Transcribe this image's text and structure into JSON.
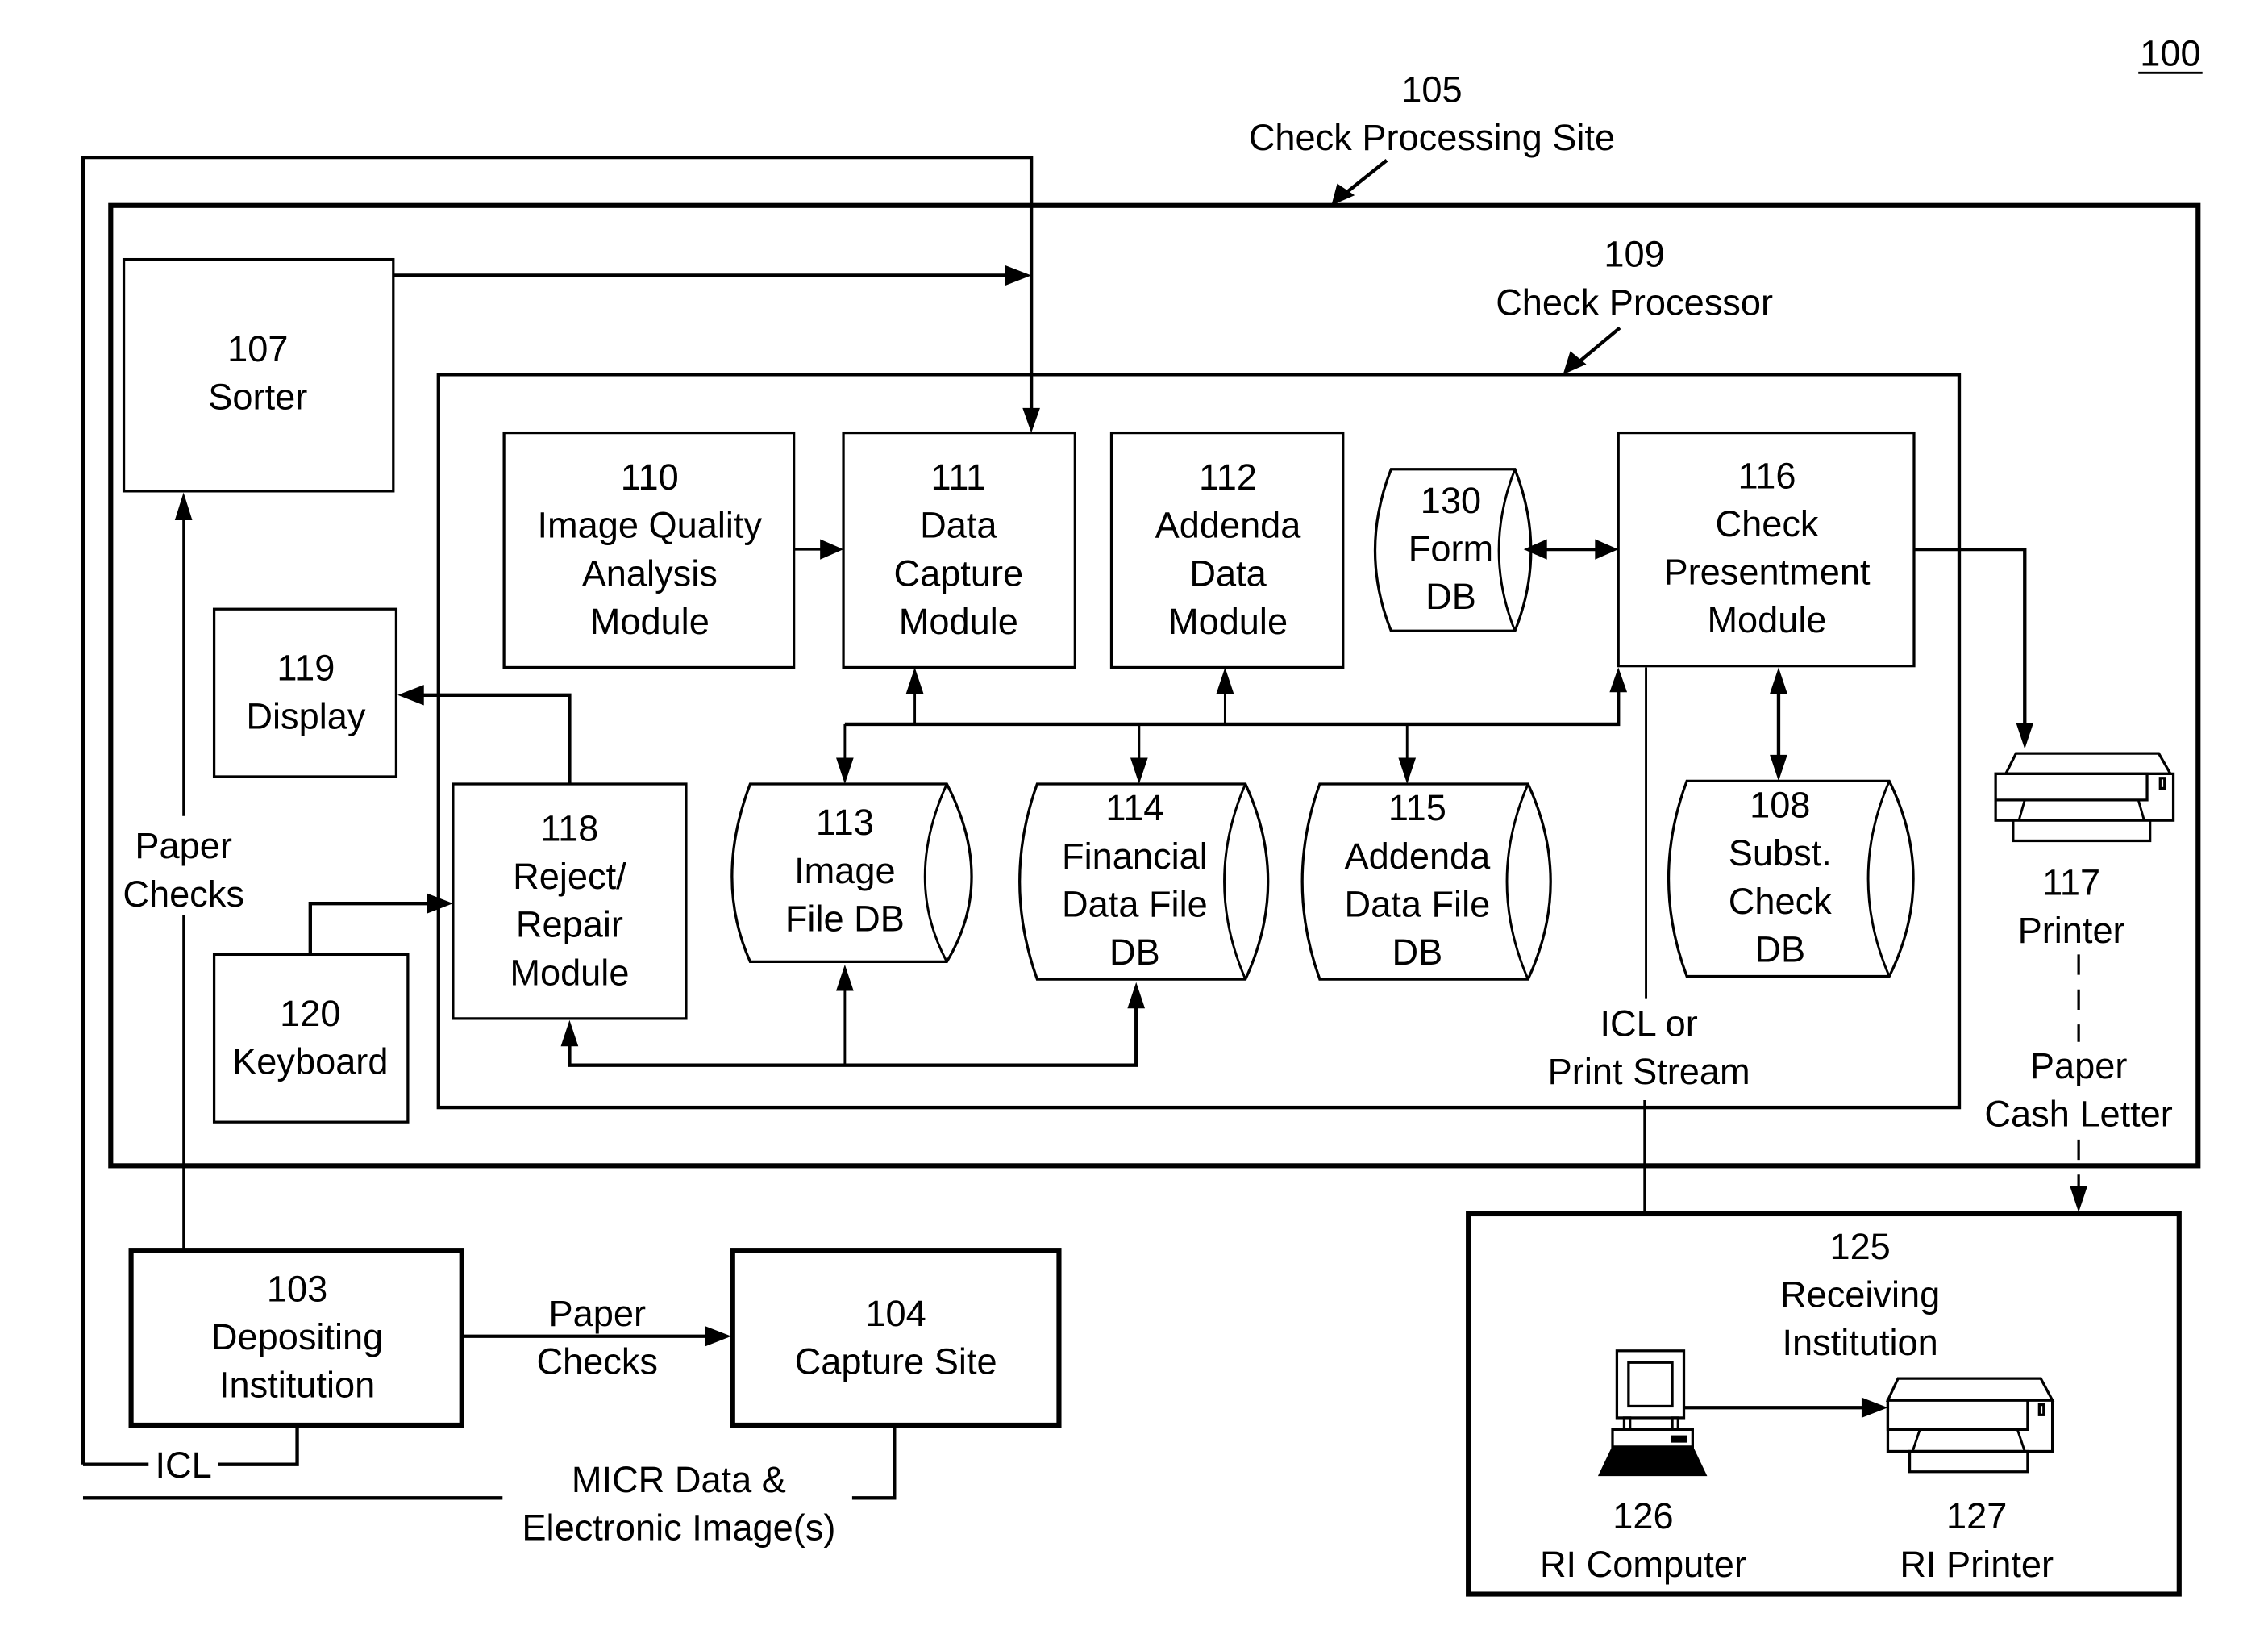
{
  "figure": {
    "ref": "100",
    "check_processing_site": {
      "number": "105",
      "label": "Check Processing Site"
    },
    "check_processor": {
      "number": "109",
      "label": "Check Processor"
    }
  },
  "nodes": {
    "sorter": {
      "number": "107",
      "lines": [
        "Sorter"
      ]
    },
    "display": {
      "number": "119",
      "lines": [
        "Display"
      ]
    },
    "keyboard": {
      "number": "120",
      "lines": [
        "Keyboard"
      ]
    },
    "image_quality": {
      "number": "110",
      "lines": [
        "Image Quality",
        "Analysis",
        "Module"
      ]
    },
    "data_capture": {
      "number": "111",
      "lines": [
        "Data",
        "Capture",
        "Module"
      ]
    },
    "addenda_data": {
      "number": "112",
      "lines": [
        "Addenda",
        "Data",
        "Module"
      ]
    },
    "form_db": {
      "number": "130",
      "lines": [
        "Form",
        "DB"
      ]
    },
    "check_presentment": {
      "number": "116",
      "lines": [
        "Check",
        "Presentment",
        "Module"
      ]
    },
    "reject_repair": {
      "number": "118",
      "lines": [
        "Reject/",
        "Repair",
        "Module"
      ]
    },
    "image_file_db": {
      "number": "113",
      "lines": [
        "Image",
        "File DB"
      ]
    },
    "financial_db": {
      "number": "114",
      "lines": [
        "Financial",
        "Data File",
        "DB"
      ]
    },
    "addenda_file_db": {
      "number": "115",
      "lines": [
        "Addenda",
        "Data File",
        "DB"
      ]
    },
    "subst_check_db": {
      "number": "108",
      "lines": [
        "Subst.",
        "Check",
        "DB"
      ]
    },
    "printer": {
      "number": "117",
      "lines": [
        "Printer"
      ]
    },
    "depositing": {
      "number": "103",
      "lines": [
        "Depositing",
        "Institution"
      ]
    },
    "capture_site": {
      "number": "104",
      "lines": [
        "Capture Site"
      ]
    },
    "receiving": {
      "number": "125",
      "lines": [
        "Receiving",
        "Institution"
      ]
    },
    "ri_computer": {
      "number": "126",
      "lines": [
        "RI Computer"
      ]
    },
    "ri_printer": {
      "number": "127",
      "lines": [
        "RI Printer"
      ]
    }
  },
  "edge_labels": {
    "paper_checks_left": [
      "Paper",
      "Checks"
    ],
    "paper_checks_bottom": [
      "Paper",
      "Checks"
    ],
    "icl": "ICL",
    "micr": [
      "MICR Data &",
      "Electronic Image(s)"
    ],
    "icl_print_stream": [
      "ICL or",
      "Print Stream"
    ],
    "paper_cash_letter": [
      "Paper",
      "Cash Letter"
    ]
  },
  "icons": {
    "printer": "printer-icon",
    "computer": "computer-icon"
  }
}
